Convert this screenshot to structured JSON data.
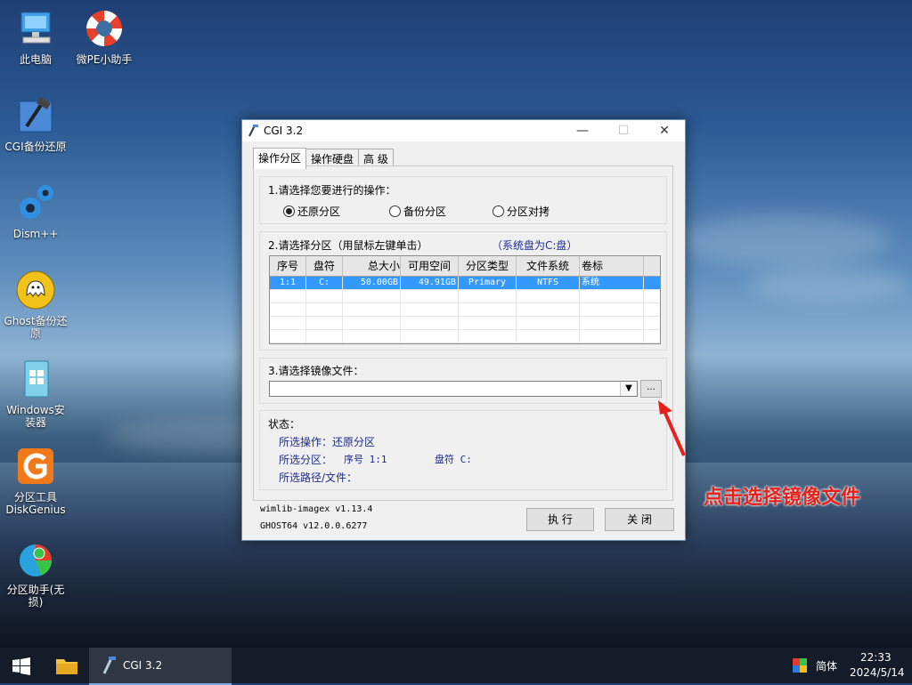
{
  "desktop": {
    "icons": [
      {
        "label": "此电脑"
      },
      {
        "label": "微PE小助手"
      },
      {
        "label": "CGI备份还原"
      },
      {
        "label": "Dism++"
      },
      {
        "label": "Ghost备份还原"
      },
      {
        "label": "Windows安装器"
      },
      {
        "label": "分区工具DiskGenius"
      },
      {
        "label": "分区助手(无损)"
      }
    ],
    "annotation": "点击选择镜像文件",
    "annotation_color": "#e8201a"
  },
  "window": {
    "title": "CGI 3.2",
    "controls": {
      "minimize": "—",
      "maximize": "☐",
      "close": "✕"
    },
    "tabs": [
      "操作分区",
      "操作硬盘",
      "高 级"
    ],
    "operation": {
      "title": "1.请选择您要进行的操作：",
      "options": [
        "还原分区",
        "备份分区",
        "分区对拷"
      ],
      "selected": "还原分区"
    },
    "partition": {
      "title": "2.请选择分区（用鼠标左键单击）",
      "system_note": "（系统盘为C:盘）",
      "columns": [
        "序号",
        "盘符",
        "总大小",
        "可用空间",
        "分区类型",
        "文件系统",
        "卷标"
      ],
      "rows": [
        [
          "1:1",
          "C:",
          "50.00GB",
          "49.91GB",
          "Primary",
          "NTFS",
          "系统"
        ]
      ]
    },
    "image": {
      "title": "3.请选择镜像文件：",
      "value": "",
      "browse_label": "..."
    },
    "status": {
      "title": "状态：",
      "operation_line": "所选操作：还原分区",
      "partition_line_label": "所选分区：",
      "partition_index": "序号 1:1",
      "partition_drive": "盘符 C:",
      "path_line": "所选路径/文件："
    },
    "versions": [
      "wimlib-imagex v1.13.4",
      "GHOST64 v12.0.0.6277"
    ],
    "buttons": {
      "execute": "执 行",
      "close": "关 闭"
    }
  },
  "taskbar": {
    "app_label": "CGI 3.2",
    "ime": "简体",
    "time": "22:33",
    "date": "2024/5/14"
  }
}
